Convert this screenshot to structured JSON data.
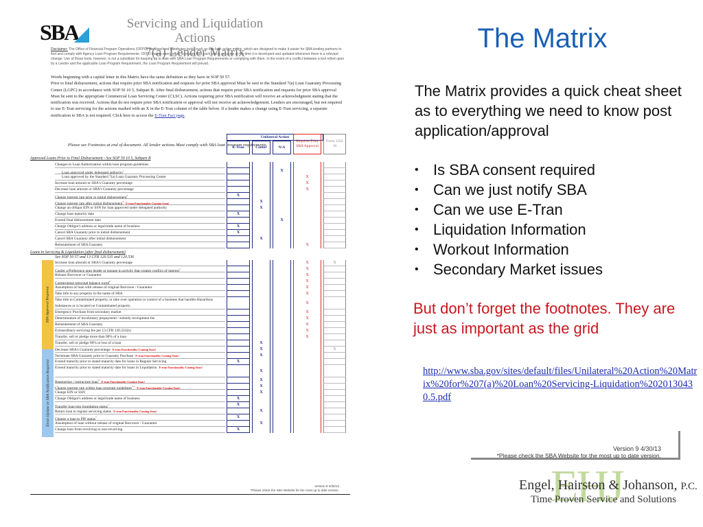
{
  "slide": {
    "title": "The Matrix",
    "intro": "The Matrix provides a quick cheat sheet as to everything we need to know post application/approval",
    "bullets": [
      "Is SBA consent required",
      "Can we just notify SBA",
      "Can we use E-Tran",
      "Liquidation Information",
      "Workout Information",
      "Secondary Market issues"
    ],
    "bullet_glyph": "•",
    "footnote_warning": "But don’t forget the footnotes.  They are just as important as the grid",
    "link_text": "http://www.sba.gov/sites/default/files/Unilateral%20Action%20Matrix%20for%207(a)%20Loan%20Servicing-Liquidation%2020130430.5.pdf",
    "version_box": {
      "version": "Version 9 4/30/13",
      "note": "*Please check the SBA Website for the most up to date version."
    },
    "firm_logo": {
      "monogram": "EHJ",
      "name": "Engel, Hairston & Johanson,",
      "suffix": "P.C.",
      "tagline": "Time Proven Service and Solutions"
    },
    "colors": {
      "title_blue": "#1a5fb4",
      "warning_red": "#c8161d",
      "link_blue": "#1a2bb0",
      "approval_band": "#f5c242",
      "notify_band": "#9cc7ee",
      "logo_green": "#b9d38e"
    }
  },
  "matrix_doc": {
    "logo": "SBA",
    "title_line1": "Servicing and Liquidation Actions",
    "title_line2": "7(a) Lender Matrix",
    "disclaimer_label": "Disclaimer:",
    "disclaimer": "The Office of Financial Program Operations (OFPO) develops and distributes tools, such as this loan action matrix, which are designed to make it easier for SBA lending partners to find and comply with Agency Loan Program Requirements. OFPO makes every effort to ensure that each tool is accurate at the time it is developed and updated whenever there is a relevant change. Use of these tools, however, is not a substitute for keeping up to date with SBA Loan Program Requirements or complying with them. In the event of a conflict between a tool relied upon by a Lender and the applicable Loan Program Requirement, the Loan Program Requirement will prevail.",
    "intro_p1": "Words beginning with a capital letter in this Matrix have the same definition as they have in SOP 50 57.",
    "intro_p2": "Prior to final disbursement, actions that require prior SBA notification and requests for prior SBA approval Must be sent to the Standard 7(a) Loan Guaranty Processing Center (LGPC) in accordance with SOP 50 10 5, Subpart B.  After final disbursement, actions that require prior SBA notification and requests for prior SBA approval Must be sent to the appropriate Commercial Loan Servicing Center (CLSC).  Actions requiring prior SBA notification will receive an acknowledgment stating that the notification was received.  Actions that do not require prior SBA notification or approval will not receive an acknowledgement.  Lenders are encouraged, but not required to use E-Tran servicing for the actions marked with an X in the E-Tran column of the table below.  If a lender makes a change using E-Tran servicing, a separate notification to SBA is not required.  Click here to access the",
    "intro_link": "E-Tran Fact page",
    "see_footnotes": "Please see Footnotes at end of document.  All lender actions Must comply with SBA loan program requirements.",
    "columns": {
      "unilateral": "Unilateral Action",
      "etran": "E-Tran",
      "center": "Center",
      "na": "N/A",
      "prior": "Requires Prior SBA Approval",
      "form": "Form 1502 10"
    },
    "section1_title": "Approved Loans Prior to Final Disbursement - See SOP 50 10 5, Subpart B",
    "section1_rows": [
      {
        "label": "Changes to Loan Authorization within loan program guidelines",
        "indent": false,
        "etran": "",
        "center": "",
        "na": "",
        "prior": "",
        "form": ""
      },
      {
        "label": "Loan approved under delegated authority",
        "sup": "1",
        "indent": true,
        "etran": "",
        "center": "",
        "na": "X",
        "prior": "",
        "form": ""
      },
      {
        "label": "Loan approved by the Standard 7(a) Loan Guaranty Processing Center",
        "indent": true,
        "etran": "",
        "center": "",
        "na": "",
        "prior": "X",
        "form": ""
      },
      {
        "label": "Increase loan amount or SBA's Guaranty percentage",
        "indent": false,
        "etran": "",
        "center": "",
        "na": "",
        "prior": "X",
        "form": ""
      },
      {
        "label": "Decrease loan amount or SBA's Guaranty percentage",
        "indent": false,
        "etran": "",
        "center": "",
        "na": "",
        "prior": "X",
        "form": ""
      },
      {
        "label": "Change interest rate prior to initial disbursement",
        "sup": "2",
        "indent": false,
        "etran": "X",
        "center": "",
        "na": "",
        "prior": "",
        "form": ""
      },
      {
        "label": "Change interest rate after initial disbursement",
        "sup": "3",
        "note": "E-tran Functionality Coming Soon!",
        "indent": false,
        "etran": "",
        "center": "X",
        "na": "",
        "prior": "",
        "form": ""
      },
      {
        "label": "Change an obligor EIN or SSN for loan approved under delegated authority",
        "indent": false,
        "etran": "",
        "center": "X",
        "na": "",
        "prior": "",
        "form": ""
      },
      {
        "label": "Change loan maturity date",
        "indent": false,
        "etran": "X",
        "center": "",
        "na": "",
        "prior": "",
        "form": ""
      },
      {
        "label": "Extend final disbursement date",
        "indent": false,
        "etran": "",
        "center": "",
        "na": "X",
        "prior": "",
        "form": ""
      },
      {
        "label": "Change Obligor's address or legal/trade name of business",
        "indent": false,
        "etran": "X",
        "center": "",
        "na": "",
        "prior": "",
        "form": ""
      },
      {
        "label": "Cancel SBA Guaranty prior to initial disbursement",
        "indent": false,
        "etran": "X",
        "center": "",
        "na": "",
        "prior": "",
        "form": ""
      },
      {
        "label": "Cancel SBA Guaranty after initial disbursement",
        "indent": false,
        "etran": "",
        "center": "X",
        "na": "",
        "prior": "",
        "form": ""
      },
      {
        "label": "Reinstatement of SBA Guaranty",
        "indent": false,
        "etran": "",
        "center": "",
        "na": "",
        "prior": "X",
        "form": ""
      }
    ],
    "section2_title": "Loans in Servicing & Liquidation (after final disbursement)",
    "section2_subtitle": "See SOP 50 57 and 13 CFR 120.535 and 120.536",
    "band_approval": "SBA Approval Required",
    "band_notify": "Etran Update or SBA Notification Required",
    "section2_rows": [
      {
        "label": "Increase loan amount or SBA's Guaranty percentage",
        "tall": false,
        "etran": "",
        "center": "",
        "na": "",
        "prior": "X",
        "form": "X"
      },
      {
        "label": "Confer a Preference onto lender or engage in activity that creates conflict of interest",
        "sup": "5",
        "tall": false,
        "etran": "",
        "center": "",
        "na": "",
        "prior": "X",
        "form": ""
      },
      {
        "label": "Release Borrower or Guarantor",
        "tall": false,
        "etran": "",
        "center": "",
        "na": "",
        "prior": "X",
        "form": ""
      },
      {
        "label": "Compromise principal balance owed",
        "sup": "6",
        "tall": false,
        "etran": "",
        "center": "",
        "na": "",
        "prior": "X",
        "form": ""
      },
      {
        "label": "Assumption of loan with release of original Borrower / Guarantor",
        "tall": false,
        "etran": "",
        "center": "",
        "na": "",
        "prior": "X",
        "form": ""
      },
      {
        "label": "Take title to any property in the name of SBA",
        "tall": false,
        "etran": "",
        "center": "",
        "na": "",
        "prior": "X",
        "form": ""
      },
      {
        "label": "Take title to Contaminated property, or take over operation or control of a business that handles Hazardous Substances or is located on Contaminated property.",
        "tall": true,
        "etran": "",
        "center": "",
        "na": "",
        "prior": "X",
        "form": ""
      },
      {
        "label": "Emergency Purchase from secondary market",
        "tall": false,
        "etran": "",
        "center": "",
        "na": "",
        "prior": "X",
        "form": ""
      },
      {
        "label": "Determination of involuntary prepayment / subsidy recoupment fee",
        "tall": false,
        "etran": "",
        "center": "",
        "na": "",
        "prior": "X",
        "form": ""
      },
      {
        "label": "Reinstatement of SBA Guaranty",
        "tall": false,
        "etran": "",
        "center": "",
        "na": "",
        "prior": "X",
        "form": ""
      },
      {
        "label": "Extraordinary servicing fee per 13 CFR 120.221(b)",
        "tall": false,
        "etran": "",
        "center": "",
        "na": "",
        "prior": "X",
        "form": ""
      },
      {
        "label": "Transfer, sell or pledge more than 90% of a loan",
        "tall": false,
        "etran": "",
        "center": "",
        "na": "",
        "prior": "X",
        "form": ""
      },
      {
        "label": "Transfer, sell or pledge 90% or less of a loan",
        "tall": false,
        "etran": "",
        "center": "X",
        "na": "",
        "prior": "",
        "form": ""
      },
      {
        "label": "Decrease SBA's Guaranty percentage",
        "note": "E-tran Functionality Coming Soon!",
        "tall": false,
        "etran": "",
        "center": "X",
        "na": "",
        "prior": "",
        "form": "X"
      },
      {
        "label": "Terminate SBA Guaranty prior to Guaranty Purchase",
        "note": "E-tran Functionality Coming Soon!",
        "tall": false,
        "etran": "",
        "center": "X",
        "na": "",
        "prior": "",
        "form": ""
      },
      {
        "label": "Extend maturity prior to stated maturity date for loans in Regular Servicing",
        "tall": false,
        "etran": "X",
        "center": "",
        "na": "",
        "prior": "",
        "form": ""
      },
      {
        "label": "Extend maturity prior to stated maturity date for loans in Liquidation",
        "note": "E-tran Functionality Coming Soon!",
        "tall": true,
        "etran": "",
        "center": "X",
        "na": "",
        "prior": "",
        "form": ""
      },
      {
        "label": "Reamortize / restructure loan",
        "sup": "6",
        "note": "E-tran Functionality Coming Soon!",
        "tall": false,
        "etran": "",
        "center": "X",
        "na": "",
        "prior": "",
        "form": ""
      },
      {
        "label": "Change interest rate within loan program guidelines",
        "sup": "2,3",
        "note": "E-tran Functionality Coming Soon!",
        "tall": false,
        "etran": "",
        "center": "X",
        "na": "",
        "prior": "",
        "form": ""
      },
      {
        "label": "Change EIN or SSN",
        "tall": false,
        "etran": "",
        "center": "X",
        "na": "",
        "prior": "",
        "form": ""
      },
      {
        "label": "Change Obligor's address or legal/trade name of business",
        "tall": false,
        "etran": "X",
        "center": "",
        "na": "",
        "prior": "",
        "form": ""
      },
      {
        "label": "Transfer loan into liquidation status",
        "sup": "7",
        "tall": false,
        "etran": "X",
        "center": "",
        "na": "",
        "prior": "",
        "form": ""
      },
      {
        "label": "Return loan to regular servicing status",
        "note": "E-tran Functionality Coming Soon!",
        "tall": false,
        "etran": "",
        "center": "X",
        "na": "",
        "prior": "",
        "form": ""
      },
      {
        "label": "Change a loan to PIF status",
        "sup": "7",
        "tall": false,
        "etran": "X",
        "center": "",
        "na": "",
        "prior": "",
        "form": ""
      },
      {
        "label": "Assumption of loan without release of original Borrower / Guarantor",
        "tall": false,
        "etran": "",
        "center": "X",
        "na": "",
        "prior": "",
        "form": ""
      },
      {
        "label": "Change loan from revolving to non-revolving",
        "tall": false,
        "etran": "X",
        "center": "",
        "na": "",
        "prior": "",
        "form": ""
      }
    ],
    "footer_version": "Version 9 4/30/13",
    "footer_note": "*Please check the SBA Website for the most up to date version."
  }
}
